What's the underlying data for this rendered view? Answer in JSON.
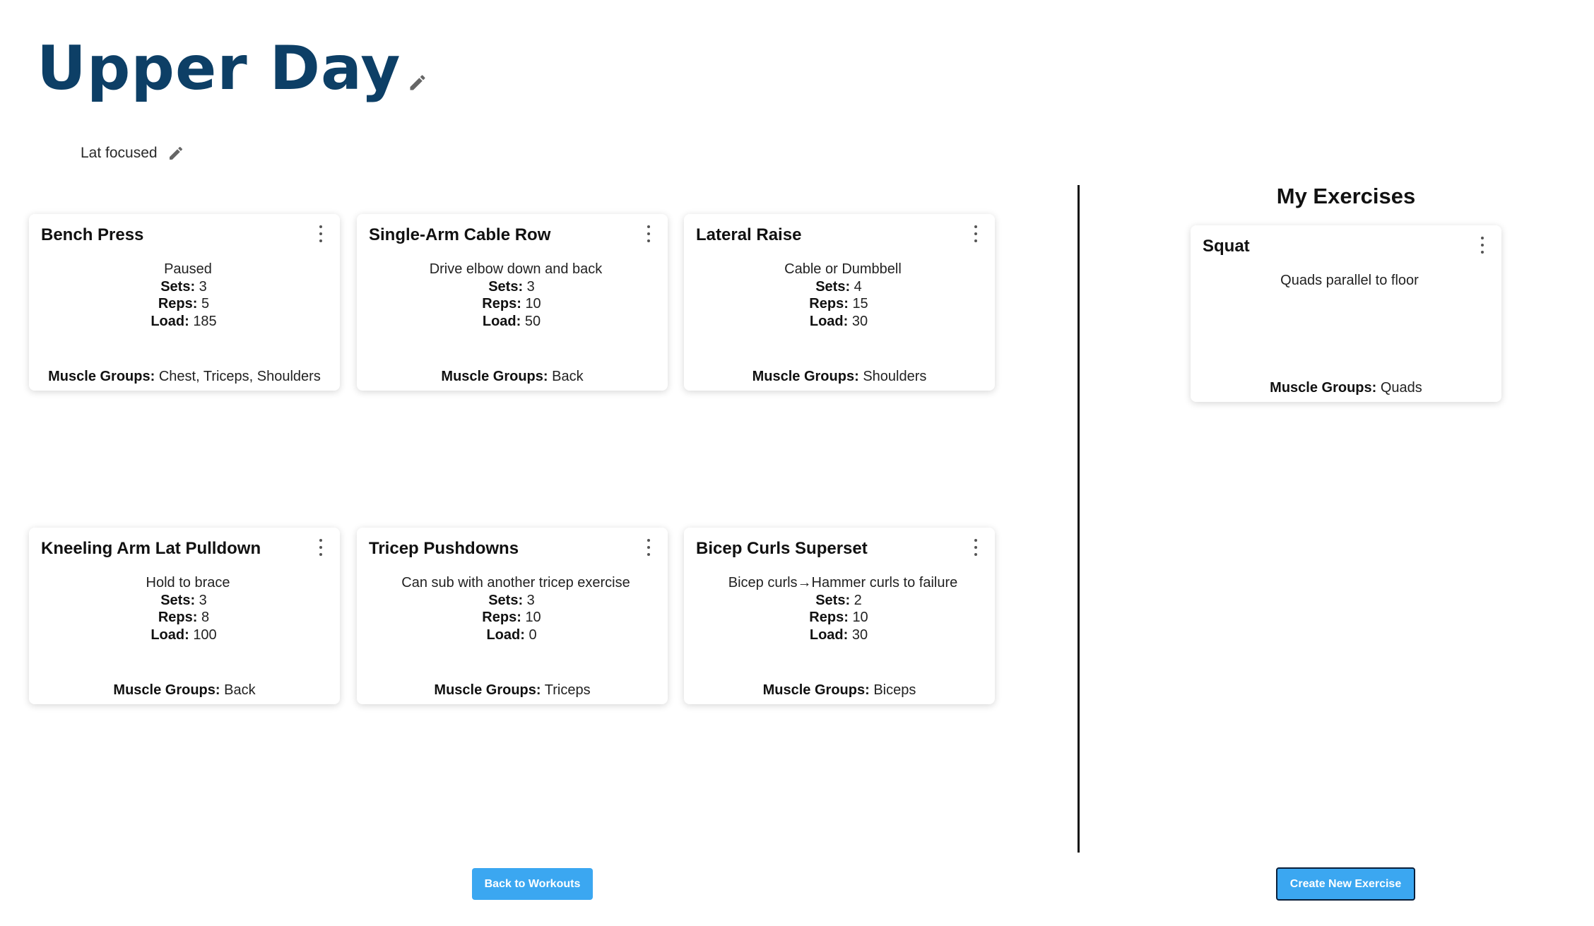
{
  "workout": {
    "title": "Upper Day",
    "description": "Lat focused"
  },
  "labels": {
    "sets": "Sets:",
    "reps": "Reps:",
    "load": "Load:",
    "muscle_groups": "Muscle Groups:"
  },
  "exercises": [
    {
      "name": "Bench Press",
      "description": "Paused",
      "sets": "3",
      "reps": "5",
      "load": "185",
      "muscle_groups": "Chest, Triceps, Shoulders"
    },
    {
      "name": "Single-Arm Cable Row",
      "description": "Drive elbow down and back",
      "sets": "3",
      "reps": "10",
      "load": "50",
      "muscle_groups": "Back"
    },
    {
      "name": "Lateral Raise",
      "description": "Cable or Dumbbell",
      "sets": "4",
      "reps": "15",
      "load": "30",
      "muscle_groups": "Shoulders"
    },
    {
      "name": "Kneeling Arm Lat Pulldown",
      "description": "Hold to brace",
      "sets": "3",
      "reps": "8",
      "load": "100",
      "muscle_groups": "Back"
    },
    {
      "name": "Tricep Pushdowns",
      "description": "Can sub with another tricep exercise",
      "sets": "3",
      "reps": "10",
      "load": "0",
      "muscle_groups": "Triceps"
    },
    {
      "name": "Bicep Curls Superset",
      "description": "Bicep curls→Hammer curls to failure",
      "sets": "2",
      "reps": "10",
      "load": "30",
      "muscle_groups": "Biceps"
    }
  ],
  "my_exercises": {
    "heading": "My Exercises",
    "items": [
      {
        "name": "Squat",
        "description": "Quads parallel to floor",
        "muscle_groups": "Quads"
      }
    ]
  },
  "buttons": {
    "back": "Back to Workouts",
    "create": "Create New Exercise"
  },
  "colors": {
    "title": "#0d3f66",
    "button": "#3ba7f1",
    "divider": "#111111"
  },
  "icons": {
    "edit": "pencil-icon",
    "menu": "more-vertical-icon"
  }
}
